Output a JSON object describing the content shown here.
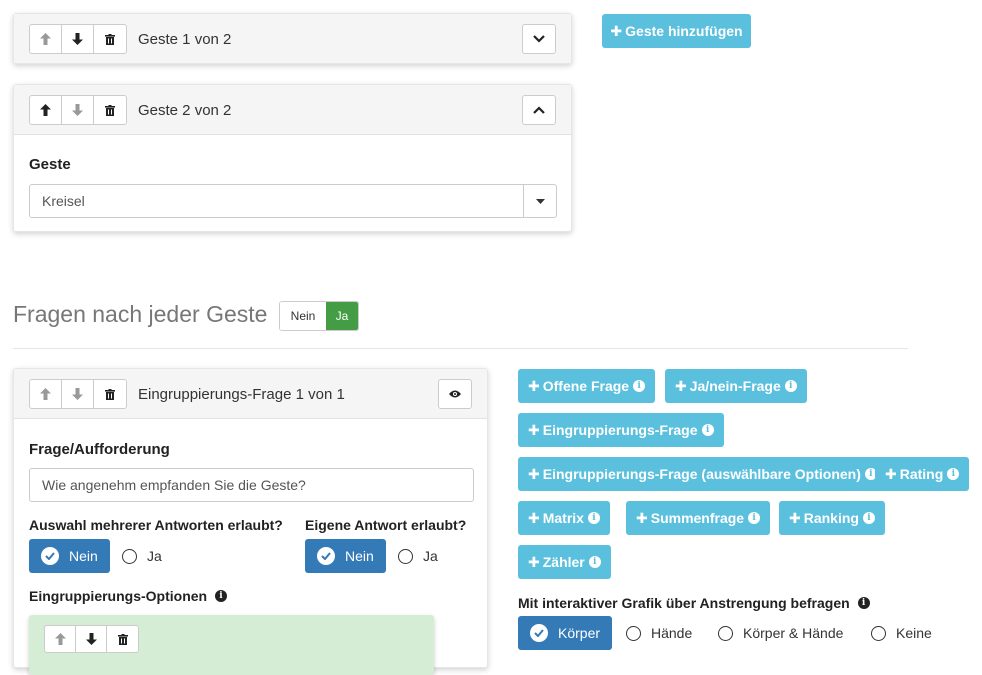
{
  "gesture_panels": {
    "panel1": {
      "title": "Geste 1 von 2",
      "collapsed": true
    },
    "panel2": {
      "title": "Geste 2 von 2",
      "field_label": "Geste",
      "select_value": "Kreisel"
    }
  },
  "add_gesture_button": "Geste hinzufügen",
  "questions_section": {
    "heading": "Fragen nach jeder Geste",
    "toggle": {
      "no": "Nein",
      "yes": "Ja",
      "selected": "Ja"
    },
    "toggle_colors": {
      "active": "#449d44"
    }
  },
  "question_panel": {
    "title": "Eingruppierungs-Frage 1 von 1",
    "prompt_label": "Frage/Aufforderung",
    "prompt_value": "Wie angenehm empfanden Sie die Geste?",
    "multi_label": "Auswahl mehrerer Antworten erlaubt?",
    "multi_options": [
      "Nein",
      "Ja"
    ],
    "multi_selected": "Nein",
    "own_label": "Eigene Antwort erlaubt?",
    "own_options": [
      "Nein",
      "Ja"
    ],
    "own_selected": "Nein",
    "options_label": "Eingruppierungs-Optionen"
  },
  "question_type_buttons": [
    "Offene Frage",
    "Ja/nein-Frage",
    "Eingruppierungs-Frage",
    "Eingruppierungs-Frage (auswählbare Optionen)",
    "Rating",
    "Matrix",
    "Summenfrage",
    "Ranking",
    "Zähler"
  ],
  "effort_question": {
    "label": "Mit interaktiver Grafik über Anstrengung befragen",
    "options": [
      "Körper",
      "Hände",
      "Körper & Hände",
      "Keine"
    ],
    "selected": "Körper"
  },
  "colors": {
    "info_button": "#5bc0de",
    "primary": "#337ab7",
    "success": "#449d44",
    "option_panel_bg": "#d5ecd5"
  }
}
